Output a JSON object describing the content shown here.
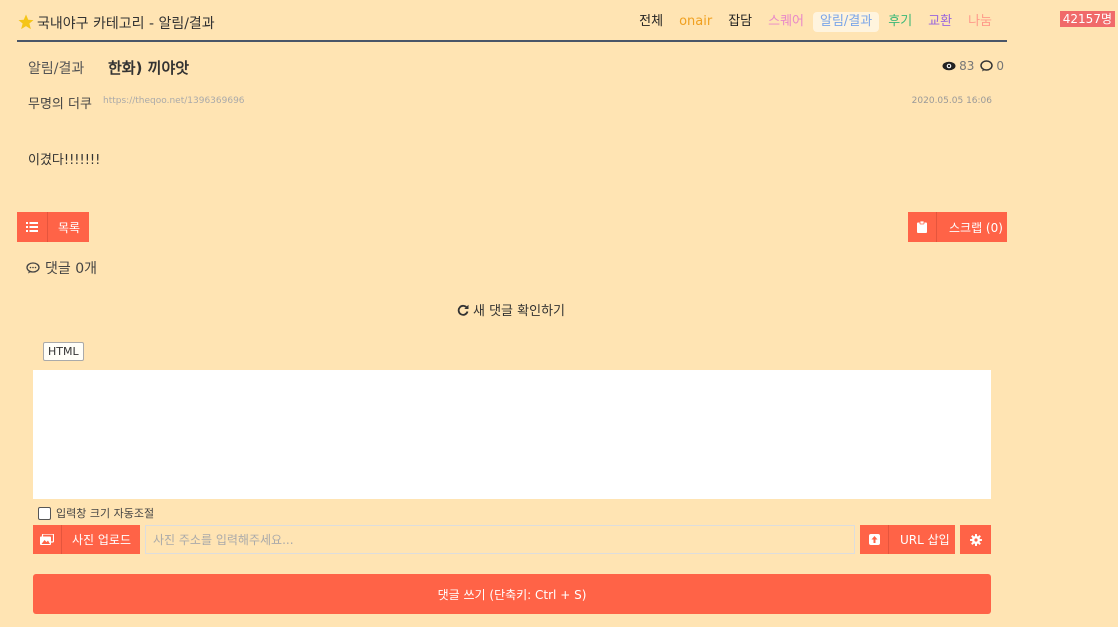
{
  "counter": "42157명",
  "header": {
    "title": "국내야구 카테고리 - 알림/결과",
    "nav": [
      {
        "label": "전체",
        "color": "#222222"
      },
      {
        "label": "onair",
        "color": "#f0a020"
      },
      {
        "label": "잡담",
        "color": "#222222"
      },
      {
        "label": "스퀘어",
        "color": "#e888c8"
      },
      {
        "label": "알림/결과",
        "color": "#7aa5e8"
      },
      {
        "label": "후기",
        "color": "#3cb878"
      },
      {
        "label": "교환",
        "color": "#9966dd"
      },
      {
        "label": "나눔",
        "color": "#ff9a8a"
      }
    ],
    "active_nav": "알림/결과"
  },
  "post": {
    "category": "알림/결과",
    "title": "한화) 끼야앗",
    "views": "83",
    "comments": "0",
    "author": "무명의 더쿠",
    "url": "https://theqoo.net/1396369696",
    "date": "2020.05.05 16:06",
    "body": "이겼다!!!!!!!"
  },
  "buttons": {
    "list": "목록",
    "scrap": "스크랩 (0)",
    "upload": "사진 업로드",
    "url_insert": "URL 삽입",
    "submit": "댓글 쓰기 (단축키: Ctrl + S)"
  },
  "comments": {
    "count_label": "댓글 0개",
    "refresh_label": "새 댓글 확인하기"
  },
  "editor": {
    "html_tab": "HTML",
    "autosize_label": "입력창 크기 자동조절",
    "autosize_checked": false,
    "url_placeholder": "사진 주소를 입력해주세요..."
  },
  "colors": {
    "background": "#ffe4b3",
    "accent": "#ff6347",
    "star": "#f5c518"
  }
}
